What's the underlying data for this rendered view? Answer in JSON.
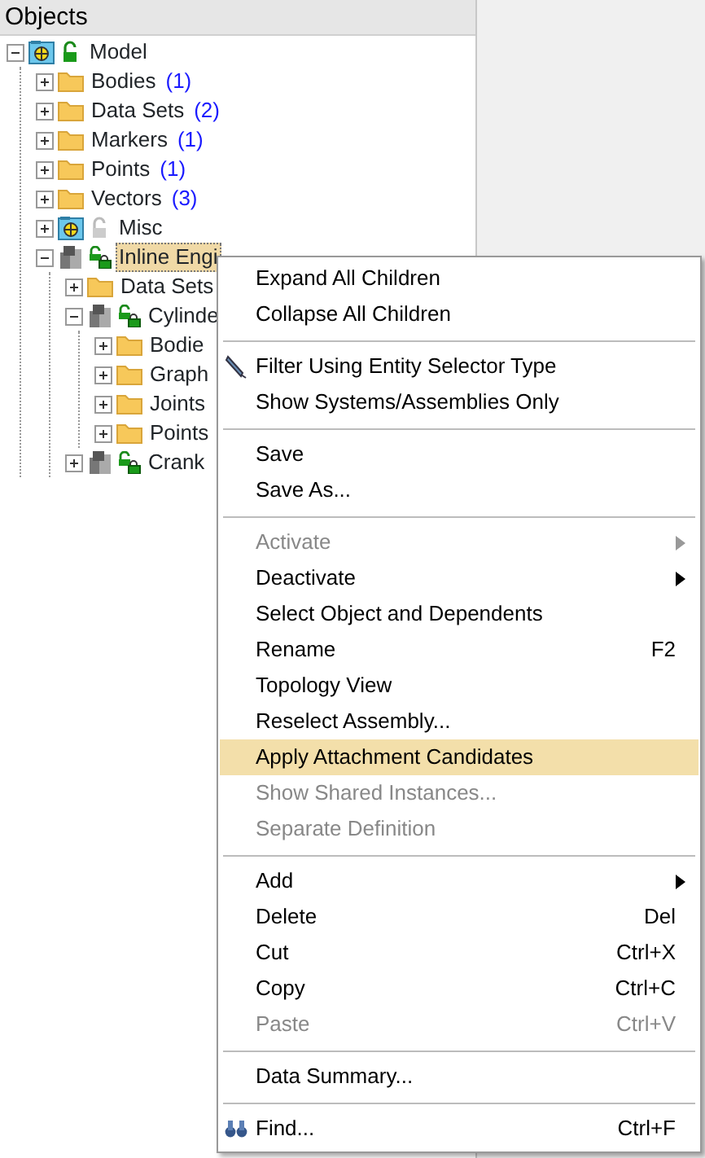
{
  "panel": {
    "title": "Objects"
  },
  "tree": [
    {
      "label": "Model",
      "kind": "model",
      "active": true,
      "expanded": true,
      "selected": false,
      "children": [
        {
          "label": "Bodies",
          "count": "(1)",
          "kind": "folder",
          "expanded": false,
          "selected": false
        },
        {
          "label": "Data Sets",
          "count": "(2)",
          "kind": "folder",
          "expanded": false,
          "selected": false
        },
        {
          "label": "Markers",
          "count": "(1)",
          "kind": "folder",
          "expanded": false,
          "selected": false
        },
        {
          "label": "Points",
          "count": "(1)",
          "kind": "folder",
          "expanded": false,
          "selected": false
        },
        {
          "label": "Vectors",
          "count": "(3)",
          "kind": "folder",
          "expanded": false,
          "selected": false
        },
        {
          "label": "Misc",
          "kind": "model",
          "active": false,
          "expanded": false,
          "selected": false
        },
        {
          "label": "Inline Engi",
          "kind": "assembly",
          "expanded": true,
          "selected": true,
          "children": [
            {
              "label": "Data Sets",
              "kind": "folder",
              "expanded": false,
              "selected": false
            },
            {
              "label": "Cylinde",
              "kind": "assembly",
              "expanded": true,
              "selected": false,
              "children": [
                {
                  "label": "Bodie",
                  "kind": "folder",
                  "expanded": false,
                  "selected": false
                },
                {
                  "label": "Graph",
                  "kind": "folder",
                  "expanded": false,
                  "selected": false
                },
                {
                  "label": "Joints",
                  "kind": "folder",
                  "expanded": false,
                  "selected": false
                },
                {
                  "label": "Points",
                  "kind": "folder",
                  "expanded": false,
                  "selected": false
                }
              ]
            },
            {
              "label": "Crank",
              "kind": "assembly",
              "expanded": false,
              "selected": false
            }
          ]
        }
      ]
    }
  ],
  "context_menu": [
    {
      "kind": "item",
      "label": "Expand All Children",
      "disabled": false,
      "selected": false
    },
    {
      "kind": "item",
      "label": "Collapse All Children",
      "disabled": false,
      "selected": false
    },
    {
      "kind": "separator"
    },
    {
      "kind": "tool",
      "label": "Filter Using Entity Selector Type",
      "disabled": false,
      "selected": false
    },
    {
      "kind": "item",
      "label": "Show Systems/Assemblies Only",
      "disabled": false,
      "selected": false
    },
    {
      "kind": "separator"
    },
    {
      "kind": "item",
      "label": "Save",
      "disabled": false,
      "selected": false
    },
    {
      "kind": "item",
      "label": "Save As...",
      "disabled": false,
      "selected": false
    },
    {
      "kind": "separator"
    },
    {
      "kind": "item",
      "label": "Activate",
      "submenu": true,
      "disabled": true,
      "selected": false
    },
    {
      "kind": "item",
      "label": "Deactivate",
      "submenu": true,
      "disabled": false,
      "selected": false
    },
    {
      "kind": "item",
      "label": "Select Object and Dependents",
      "disabled": false,
      "selected": false
    },
    {
      "kind": "item",
      "label": "Rename",
      "shortcut": "F2",
      "disabled": false,
      "selected": false
    },
    {
      "kind": "item",
      "label": "Topology View",
      "disabled": false,
      "selected": false
    },
    {
      "kind": "item",
      "label": "Reselect Assembly...",
      "disabled": false,
      "selected": false
    },
    {
      "kind": "item",
      "label": "Apply Attachment Candidates",
      "disabled": false,
      "selected": true
    },
    {
      "kind": "item",
      "label": "Show Shared Instances...",
      "disabled": true,
      "selected": false
    },
    {
      "kind": "item",
      "label": "Separate Definition",
      "disabled": true,
      "selected": false
    },
    {
      "kind": "separator"
    },
    {
      "kind": "item",
      "label": "Add",
      "submenu": true,
      "disabled": false,
      "selected": false
    },
    {
      "kind": "item",
      "label": "Delete",
      "shortcut": "Del",
      "disabled": false,
      "selected": false
    },
    {
      "kind": "item",
      "label": "Cut",
      "shortcut": "Ctrl+X",
      "disabled": false,
      "selected": false
    },
    {
      "kind": "item",
      "label": "Copy",
      "shortcut": "Ctrl+C",
      "disabled": false,
      "selected": false
    },
    {
      "kind": "item",
      "label": "Paste",
      "shortcut": "Ctrl+V",
      "disabled": true,
      "selected": false
    },
    {
      "kind": "separator"
    },
    {
      "kind": "item",
      "label": "Data Summary...",
      "disabled": false,
      "selected": false
    },
    {
      "kind": "separator"
    },
    {
      "kind": "tool",
      "label": "Find...",
      "shortcut": "Ctrl+F",
      "disabled": false,
      "selected": false
    }
  ]
}
